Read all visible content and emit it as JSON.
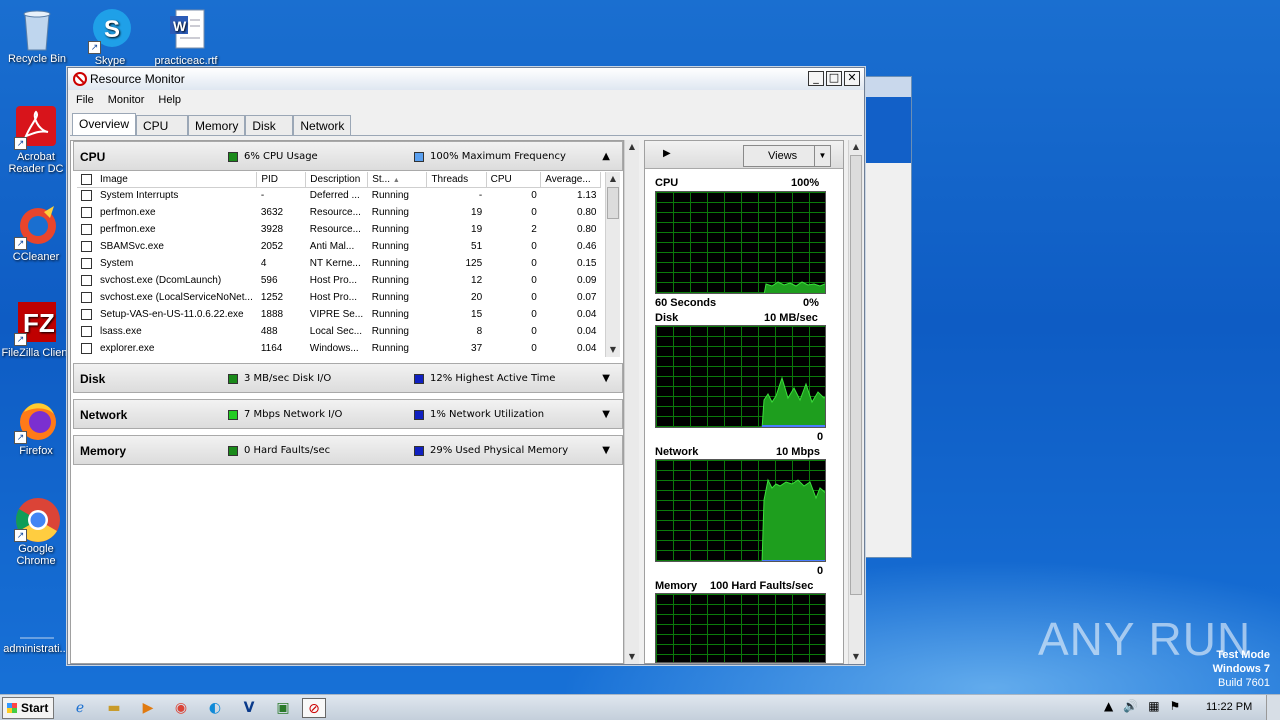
{
  "desktop": {
    "icons": [
      {
        "label": "Recycle Bin",
        "icon": "recycle-bin-icon"
      },
      {
        "label": "Skype",
        "icon": "skype-icon"
      },
      {
        "label": "practiceac.rtf",
        "icon": "word-document-icon"
      },
      {
        "label": "Acrobat Reader DC",
        "icon": "acrobat-icon"
      },
      {
        "label": "CCleaner",
        "icon": "ccleaner-icon"
      },
      {
        "label": "FileZilla Client",
        "icon": "filezilla-icon"
      },
      {
        "label": "Firefox",
        "icon": "firefox-icon"
      },
      {
        "label": "Google Chrome",
        "icon": "chrome-icon"
      },
      {
        "label": "administrati...",
        "icon": "folder-icon"
      }
    ],
    "watermark": {
      "line1": "Test Mode",
      "line2": "Windows 7",
      "line3": "Build 7601",
      "logo": "ANY RUN"
    }
  },
  "window": {
    "title": "Resource Monitor",
    "buttons": {
      "minimize": "_",
      "maximize": "□",
      "close": "✕"
    },
    "menu": [
      "File",
      "Monitor",
      "Help"
    ],
    "tabs": [
      "Overview",
      "CPU",
      "Memory",
      "Disk",
      "Network"
    ],
    "active_tab": "Overview"
  },
  "cpu_section": {
    "name": "CPU",
    "ind1": "6% CPU Usage",
    "ind1_color": "#1a8a1a",
    "ind2": "100% Maximum Frequency",
    "ind2_color": "#5aa0f0",
    "columns": [
      "Image",
      "PID",
      "Description",
      "St...",
      "Threads",
      "CPU",
      "Average..."
    ],
    "rows": [
      {
        "image": "System Interrupts",
        "pid": "-",
        "desc": "Deferred ...",
        "status": "Running",
        "threads": "-",
        "cpu": "0",
        "avg": "1.13"
      },
      {
        "image": "perfmon.exe",
        "pid": "3632",
        "desc": "Resource...",
        "status": "Running",
        "threads": "19",
        "cpu": "0",
        "avg": "0.80"
      },
      {
        "image": "perfmon.exe",
        "pid": "3928",
        "desc": "Resource...",
        "status": "Running",
        "threads": "19",
        "cpu": "2",
        "avg": "0.80"
      },
      {
        "image": "SBAMSvc.exe",
        "pid": "2052",
        "desc": "Anti Mal...",
        "status": "Running",
        "threads": "51",
        "cpu": "0",
        "avg": "0.46"
      },
      {
        "image": "System",
        "pid": "4",
        "desc": "NT Kerne...",
        "status": "Running",
        "threads": "125",
        "cpu": "0",
        "avg": "0.15"
      },
      {
        "image": "svchost.exe (DcomLaunch)",
        "pid": "596",
        "desc": "Host Pro...",
        "status": "Running",
        "threads": "12",
        "cpu": "0",
        "avg": "0.09"
      },
      {
        "image": "svchost.exe (LocalServiceNoNet...",
        "pid": "1252",
        "desc": "Host Pro...",
        "status": "Running",
        "threads": "20",
        "cpu": "0",
        "avg": "0.07"
      },
      {
        "image": "Setup-VAS-en-US-11.0.6.22.exe",
        "pid": "1888",
        "desc": "VIPRE Se...",
        "status": "Running",
        "threads": "15",
        "cpu": "0",
        "avg": "0.04"
      },
      {
        "image": "lsass.exe",
        "pid": "488",
        "desc": "Local Sec...",
        "status": "Running",
        "threads": "8",
        "cpu": "0",
        "avg": "0.04"
      },
      {
        "image": "explorer.exe",
        "pid": "1164",
        "desc": "Windows...",
        "status": "Running",
        "threads": "37",
        "cpu": "0",
        "avg": "0.04"
      }
    ]
  },
  "disk_section": {
    "name": "Disk",
    "ind1": "3 MB/sec Disk I/O",
    "ind1_color": "#1a8a1a",
    "ind2": "12% Highest Active Time",
    "ind2_color": "#1020c0"
  },
  "network_section": {
    "name": "Network",
    "ind1": "7 Mbps Network I/O",
    "ind1_color": "#22cc22",
    "ind2": "1% Network Utilization",
    "ind2_color": "#1020c0"
  },
  "memory_section": {
    "name": "Memory",
    "ind1": "0 Hard Faults/sec",
    "ind1_color": "#1a8a1a",
    "ind2": "29% Used Physical Memory",
    "ind2_color": "#1020c0"
  },
  "right_pane": {
    "views_label": "Views",
    "cpu_graph": {
      "label": "CPU",
      "max": "100%",
      "time": "60 Seconds",
      "min": "0%"
    },
    "disk_graph": {
      "label": "Disk",
      "max": "10 MB/sec",
      "min": "0"
    },
    "network_graph": {
      "label": "Network",
      "max": "10 Mbps",
      "min": "0"
    },
    "memory_graph": {
      "label": "Memory",
      "max": "100 Hard Faults/sec"
    }
  },
  "taskbar": {
    "start_label": "Start",
    "items": [
      "ie-icon",
      "explorer-icon",
      "media-player-icon",
      "chrome-icon",
      "edge-icon",
      "vipre-icon",
      "task-icon",
      "resource-monitor-icon"
    ],
    "clock": "11:22 PM"
  }
}
